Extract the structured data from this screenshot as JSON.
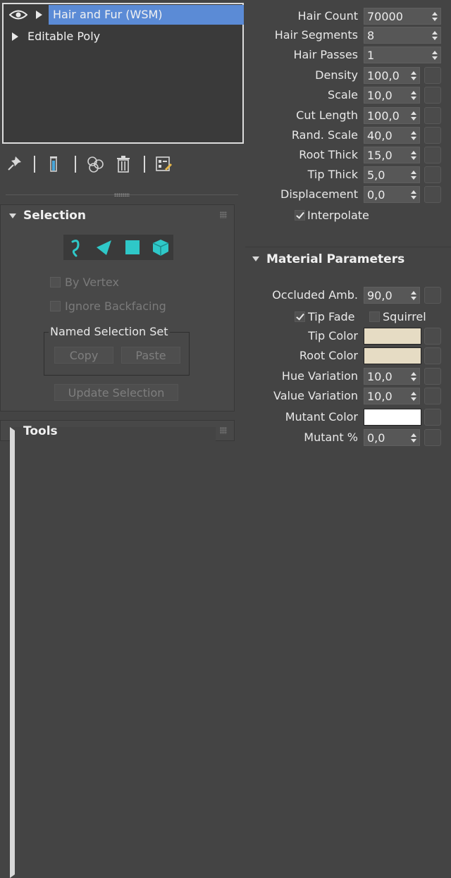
{
  "modifier_stack": {
    "items": [
      {
        "label": "Hair and Fur (WSM)",
        "selected": true
      },
      {
        "label": "Editable Poly",
        "selected": false
      }
    ]
  },
  "stack_toolbar": {
    "icons": [
      "pin-stack-icon",
      "show-end-result-icon",
      "make-unique-icon",
      "remove-modifier-icon",
      "configure-modifier-sets-icon"
    ]
  },
  "selection_rollout": {
    "title": "Selection",
    "level_icons": [
      "guide-icon",
      "face-icon",
      "polygon-icon",
      "element-icon"
    ],
    "by_vertex": "By Vertex",
    "ignore_backfacing": "Ignore Backfacing",
    "named_selection_set": "Named Selection Set",
    "copy": "Copy",
    "paste": "Paste",
    "update_selection": "Update Selection"
  },
  "tools_rollout": {
    "title": "Tools"
  },
  "general_parameters": [
    {
      "label": "Hair Count",
      "value": "70000",
      "has_map": false
    },
    {
      "label": "Hair Segments",
      "value": "8",
      "has_map": false
    },
    {
      "label": "Hair Passes",
      "value": "1",
      "has_map": false
    },
    {
      "label": "Density",
      "value": "100,0",
      "has_map": true
    },
    {
      "label": "Scale",
      "value": "10,0",
      "has_map": true
    },
    {
      "label": "Cut Length",
      "value": "100,0",
      "has_map": true
    },
    {
      "label": "Rand. Scale",
      "value": "40,0",
      "has_map": true
    },
    {
      "label": "Root Thick",
      "value": "15,0",
      "has_map": true
    },
    {
      "label": "Tip Thick",
      "value": "5,0",
      "has_map": true
    },
    {
      "label": "Displacement",
      "value": "0,0",
      "has_map": true
    }
  ],
  "interpolate": {
    "label": "Interpolate",
    "checked": true
  },
  "material_parameters": {
    "title": "Material Parameters",
    "occluded_amb": {
      "label": "Occluded Amb.",
      "value": "90,0"
    },
    "tip_fade": {
      "label": "Tip Fade",
      "checked": true
    },
    "squirrel": {
      "label": "Squirrel",
      "checked": false
    },
    "tip_color": {
      "label": "Tip Color",
      "color": "#e6dcc4"
    },
    "root_color": {
      "label": "Root Color",
      "color": "#e6dcc4"
    },
    "hue_variation": {
      "label": "Hue Variation",
      "value": "10,0"
    },
    "value_variation": {
      "label": "Value Variation",
      "value": "10,0"
    },
    "mutant_color": {
      "label": "Mutant Color",
      "color": "#ffffff"
    },
    "mutant_percent": {
      "label": "Mutant %",
      "value": "0,0"
    }
  },
  "colors": {
    "selection_highlight": "#5b8bd6",
    "panel_bg": "#444444",
    "disabled_text": "#7a7a7a"
  }
}
